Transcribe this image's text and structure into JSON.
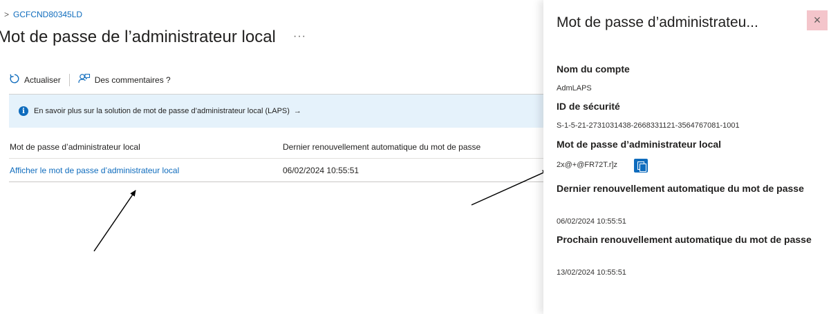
{
  "breadcrumb": {
    "separator": ">",
    "device": "GCFCND80345LD"
  },
  "page": {
    "title": "Mot de passe de l’administrateur local",
    "more": "···"
  },
  "toolbar": {
    "refresh_label": "Actualiser",
    "feedback_label": "Des commentaires ?"
  },
  "info": {
    "text": "En savoir plus sur la solution de mot de passe d’administrateur local (LAPS)",
    "arrow": "→",
    "icon_glyph": "i"
  },
  "table": {
    "headers": [
      "Mot de passe d’administrateur local",
      "Dernier renouvellement automatique du mot de passe"
    ],
    "rows": [
      {
        "password_link": "Afficher le mot de passe d’administrateur local",
        "last_rotation": "06/02/2024 10:55:51"
      }
    ]
  },
  "panel": {
    "title": "Mot de passe d’administrateu...",
    "close_glyph": "×",
    "fields": [
      {
        "label": "Nom du compte",
        "value": "AdmLAPS"
      },
      {
        "label": "ID de sécurité",
        "value": "S-1-5-21-2731031438-2668331121-3564767081-1001"
      },
      {
        "label": "Mot de passe d’administrateur local",
        "value": "2x@+@FR72T.r]z"
      },
      {
        "label": "Dernier renouvellement automatique du mot de passe",
        "value": "06/02/2024 10:55:51"
      },
      {
        "label": "Prochain renouvellement automatique du mot de passe",
        "value": "13/02/2024 10:55:51"
      }
    ]
  },
  "icons": {
    "refresh": "refresh-icon",
    "feedback": "feedback-icon",
    "info": "info-icon",
    "copy": "copy-icon",
    "close": "close-icon"
  },
  "colors": {
    "accent": "#0f6cbd",
    "info_bg": "#e5f2fb",
    "close_bg": "#f4c5cb"
  }
}
